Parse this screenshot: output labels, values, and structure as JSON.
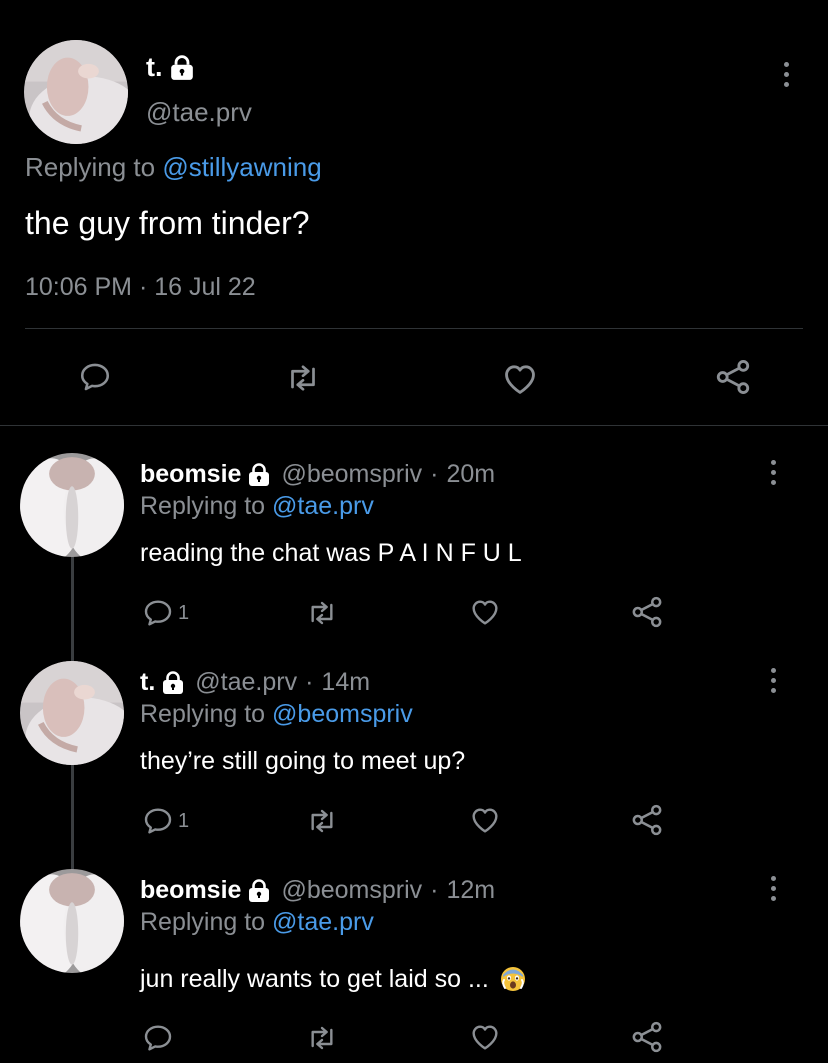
{
  "main_tweet": {
    "name": "t.",
    "handle": "@tae.prv",
    "replying_prefix": "Replying to",
    "replying_handle": "@stillyawning",
    "text": "the guy from tinder?",
    "timestamp": "10:06 PM · 16 Jul 22"
  },
  "replies": [
    {
      "name": "beomsie",
      "handle": "@beomspriv",
      "time_sep": "·",
      "time": "20m",
      "replying_prefix": "Replying to",
      "replying_handle": "@tae.prv",
      "text": "reading the chat was P A I N F U L",
      "reply_count": "1"
    },
    {
      "name": "t.",
      "handle": "@tae.prv",
      "time_sep": "·",
      "time": "14m",
      "replying_prefix": "Replying to",
      "replying_handle": "@beomspriv",
      "text": "they’re still going to meet up?",
      "reply_count": "1"
    },
    {
      "name": "beomsie",
      "handle": "@beomspriv",
      "time_sep": "·",
      "time": "12m",
      "replying_prefix": "Replying to",
      "replying_handle": "@tae.prv",
      "text": "jun really wants to get laid so ...",
      "reply_count": ""
    }
  ],
  "colors": {
    "background": "#000000",
    "link": "#4a9be8",
    "muted": "#8b8f94",
    "divider": "#2f3336"
  },
  "icons": [
    "lock-icon",
    "more-icon",
    "reply-icon",
    "retweet-icon",
    "like-icon",
    "share-icon",
    "fearful-face-emoji"
  ]
}
